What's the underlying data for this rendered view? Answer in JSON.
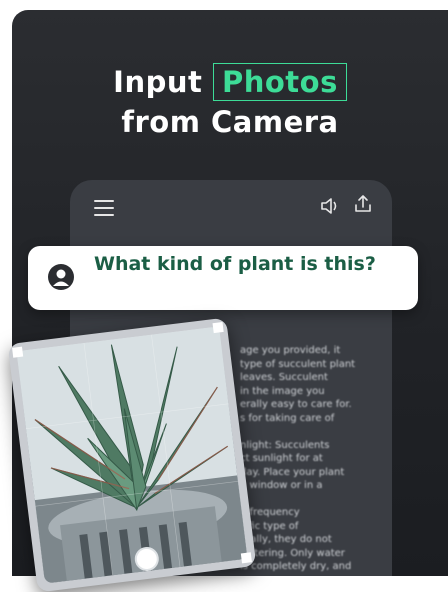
{
  "headline": {
    "line1_prefix": "Input",
    "line1_highlight": "Photos",
    "line2": "from Camera"
  },
  "chat": {
    "question": "What kind of plant is this?",
    "answer_text": "age you provided, it\ntype of succulent plant\nleaves. Succulent\nin the image you\nerally easy to care for.\ns for taking care of\n\nnlight: Succulents\nct sunlight for at\nday. Place your plant\ng window or in a\n\ng frequency\ncific type of\nerally, they do not\nwatering. Only water\nis completely dry, and"
  },
  "icons": {
    "menu": "hamburger-menu-icon",
    "speaker": "speaker-icon",
    "share": "share-icon",
    "user": "user-avatar-icon",
    "shutter": "camera-shutter-icon"
  },
  "colors": {
    "accent": "#3ddc97",
    "question_text": "#1b5e45",
    "background": "#25272b"
  }
}
